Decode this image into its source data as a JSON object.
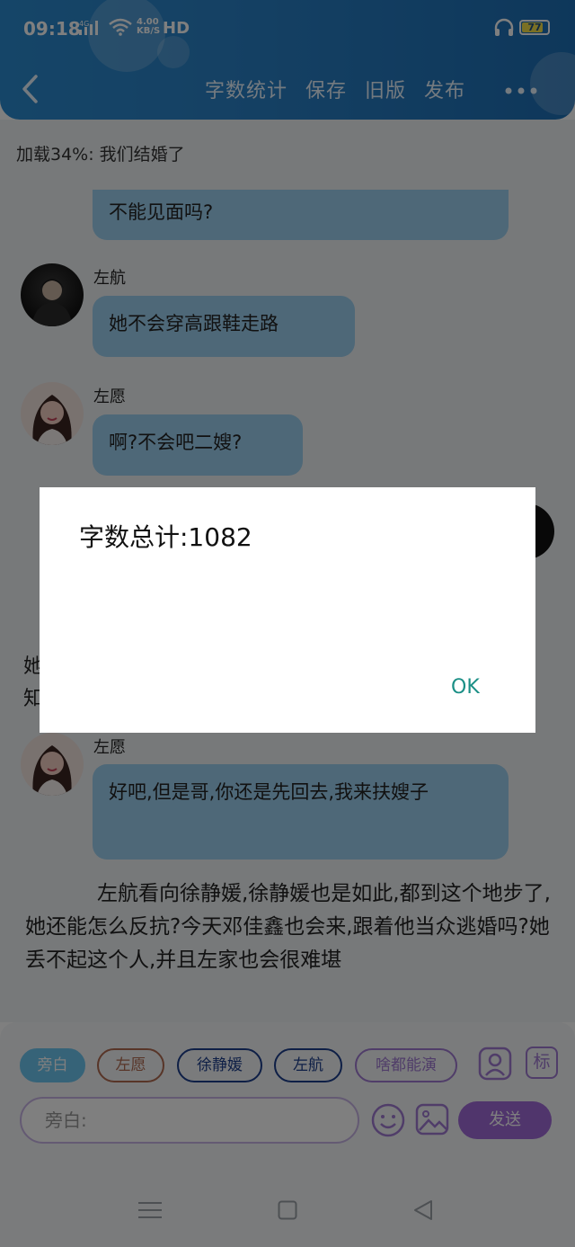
{
  "status_bar": {
    "time": "09:18",
    "network": "4G",
    "speed_value": "4.00",
    "speed_unit": "KB/S",
    "hd": "HD",
    "battery": "77"
  },
  "header": {
    "actions": [
      "字数统计",
      "保存",
      "旧版",
      "发布"
    ]
  },
  "chat": {
    "loading_text": "加载34%: 我们结婚了",
    "messages": [
      {
        "sender": "",
        "text": "不能见面吗?"
      },
      {
        "sender": "左航",
        "text": "她不会穿高跟鞋走路"
      },
      {
        "sender": "左愿",
        "text": "啊?不会吧二嫂?"
      },
      {
        "sender": "左愿",
        "text": "好吧,但是哥,你还是先回去,我来扶嫂子"
      }
    ],
    "edge_fragments": [
      "她",
      "知"
    ],
    "narration": "左航看向徐静媛,徐静媛也是如此,都到这个地步了,她还能怎么反抗?今天邓佳鑫也会来,跟着他当众逃婚吗?她丢不起这个人,并且左家也会很难堪"
  },
  "dialog": {
    "message": "字数总计:1082",
    "ok_label": "OK"
  },
  "input_area": {
    "roles": [
      "旁白",
      "左愿",
      "徐静媛",
      "左航",
      "啥都能演"
    ],
    "role_colors": [
      "#6cc6f1",
      "#b06b50",
      "#1d3e8c",
      "#1d3e8c",
      "#a07ad2"
    ],
    "tag_label": "标",
    "input_placeholder": "旁白:",
    "send_label": "发送"
  }
}
